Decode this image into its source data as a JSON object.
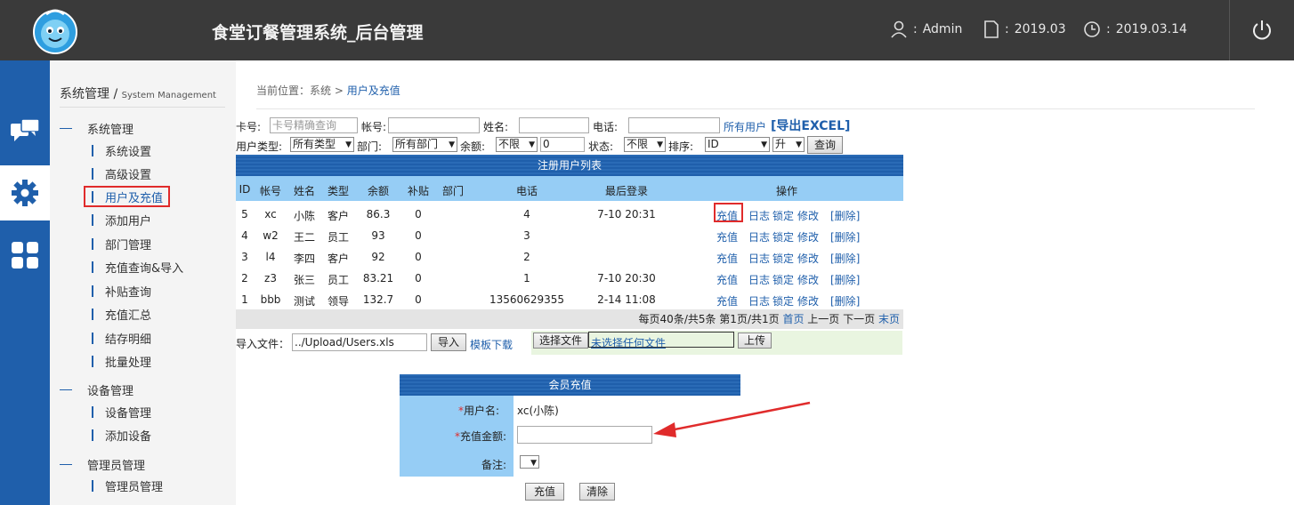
{
  "header": {
    "title": "食堂订餐管理系统_后台管理",
    "user": "Admin",
    "period": "2019.03",
    "date": "2019.03.14",
    "sep": ":"
  },
  "sidebar": {
    "title": "系统管理",
    "subtitle": "System Management",
    "groups": [
      {
        "label": "系统管理",
        "items": [
          "系统设置",
          "高级设置",
          "用户及充值",
          "添加用户",
          "部门管理",
          "充值查询&导入",
          "补贴查询",
          "充值汇总",
          "结存明细",
          "批量处理"
        ]
      },
      {
        "label": "设备管理",
        "items": [
          "设备管理",
          "添加设备"
        ]
      },
      {
        "label": "管理员管理",
        "items": [
          "管理员管理"
        ]
      }
    ]
  },
  "breadcrumb": {
    "prefix": "当前位置：系统 >",
    "current": "用户及充值"
  },
  "filters": {
    "card_label": "卡号:",
    "card_placeholder": "卡号精确查询",
    "account_label": "帐号:",
    "name_label": "姓名:",
    "phone_label": "电话:",
    "all_users": "所有用户",
    "export": "[导出EXCEL]",
    "type_label": "用户类型:",
    "type_value": "所有类型",
    "dept_label": "部门:",
    "dept_value": "所有部门",
    "balance_label": "余额:",
    "balance_op": "不限",
    "balance_value": "0",
    "status_label": "状态:",
    "status_value": "不限",
    "sort_label": "排序:",
    "sort_value": "ID",
    "order_value": "升",
    "query_btn": "查询"
  },
  "table": {
    "title": "注册用户列表",
    "headers": [
      "ID",
      "帐号",
      "姓名",
      "类型",
      "余额",
      "补贴",
      "部门",
      "电话",
      "最后登录",
      "操作"
    ],
    "rows": [
      [
        "5",
        "xc",
        "小陈",
        "客户",
        "86.3",
        "0",
        "",
        "4",
        "7-10 20:31"
      ],
      [
        "4",
        "w2",
        "王二",
        "员工",
        "93",
        "0",
        "",
        "3",
        ""
      ],
      [
        "3",
        "l4",
        "李四",
        "客户",
        "92",
        "0",
        "",
        "2",
        ""
      ],
      [
        "2",
        "z3",
        "张三",
        "员工",
        "83.21",
        "0",
        "",
        "1",
        "7-10 20:30"
      ],
      [
        "1",
        "bbb",
        "测试",
        "领导",
        "132.7",
        "0",
        "",
        "13560629355",
        "2-14 11:08"
      ]
    ],
    "ops": [
      "充值",
      "日志",
      "锁定",
      "修改",
      "[删除]"
    ],
    "pager_text": "每页40条/共5条 第1页/共1页",
    "first": "首页",
    "prev": "上一页",
    "next": "下一页",
    "last": "末页"
  },
  "import": {
    "label": "导入文件：",
    "file": "../Upload/Users.xls",
    "btn": "导入",
    "template": "模板下载",
    "choose": "选择文件",
    "no_file": "未选择任何文件",
    "upload": "上传"
  },
  "recharge": {
    "title": "会员充值",
    "username_label": "用户名:",
    "username_value": "xc(小陈)",
    "amount_label": "充值金额:",
    "note_label": "备注:",
    "submit": "充值",
    "clear": "清除",
    "asterisk": "*"
  },
  "colors": {
    "topbar": "#3a3a3a",
    "nav": "#1f5fab",
    "header_row": "#96cdf5",
    "highlight": "#e02b2b"
  }
}
